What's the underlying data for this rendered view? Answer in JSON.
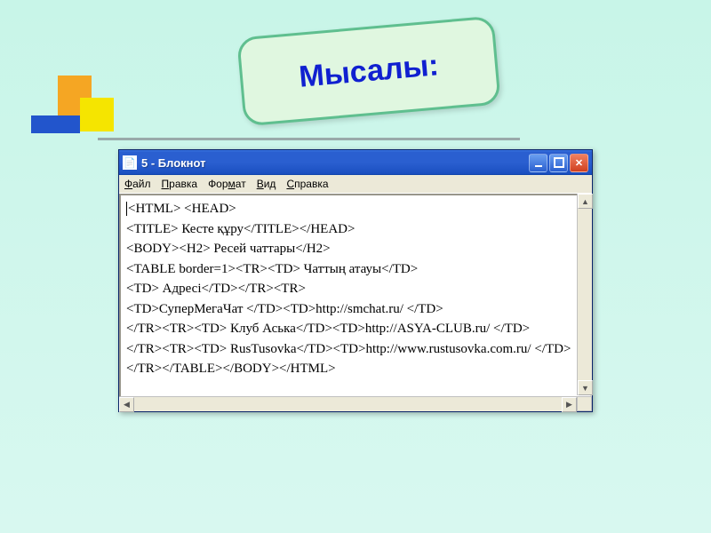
{
  "callout": {
    "text": "Мысалы:"
  },
  "window": {
    "title": "5 - Блокнот",
    "icon_glyph": "📄"
  },
  "menu": {
    "file": "Файл",
    "edit": "Правка",
    "format": "Формат",
    "view": "Вид",
    "help": "Справка"
  },
  "content": {
    "lines": [
      "<HTML> <HEAD>",
      "<TITLE> Кесте құру</TITLE></HEAD>",
      "<BODY><H2> Ресей чаттары</H2>",
      "<TABLE border=1><TR><TD> Чаттың атауы</TD>",
      "<TD> Адресі</TD></TR><TR>",
      "<TD>СуперМегаЧат </TD><TD>http://smchat.ru/ </TD>",
      "</TR><TR><TD> Клуб Аська</TD><TD>http://ASYA-CLUB.ru/ </TD>",
      "</TR><TR><TD> RusTusovka</TD><TD>http://www.rustusovka.com.ru/ </TD>",
      "</TR></TABLE></BODY></HTML>"
    ]
  }
}
